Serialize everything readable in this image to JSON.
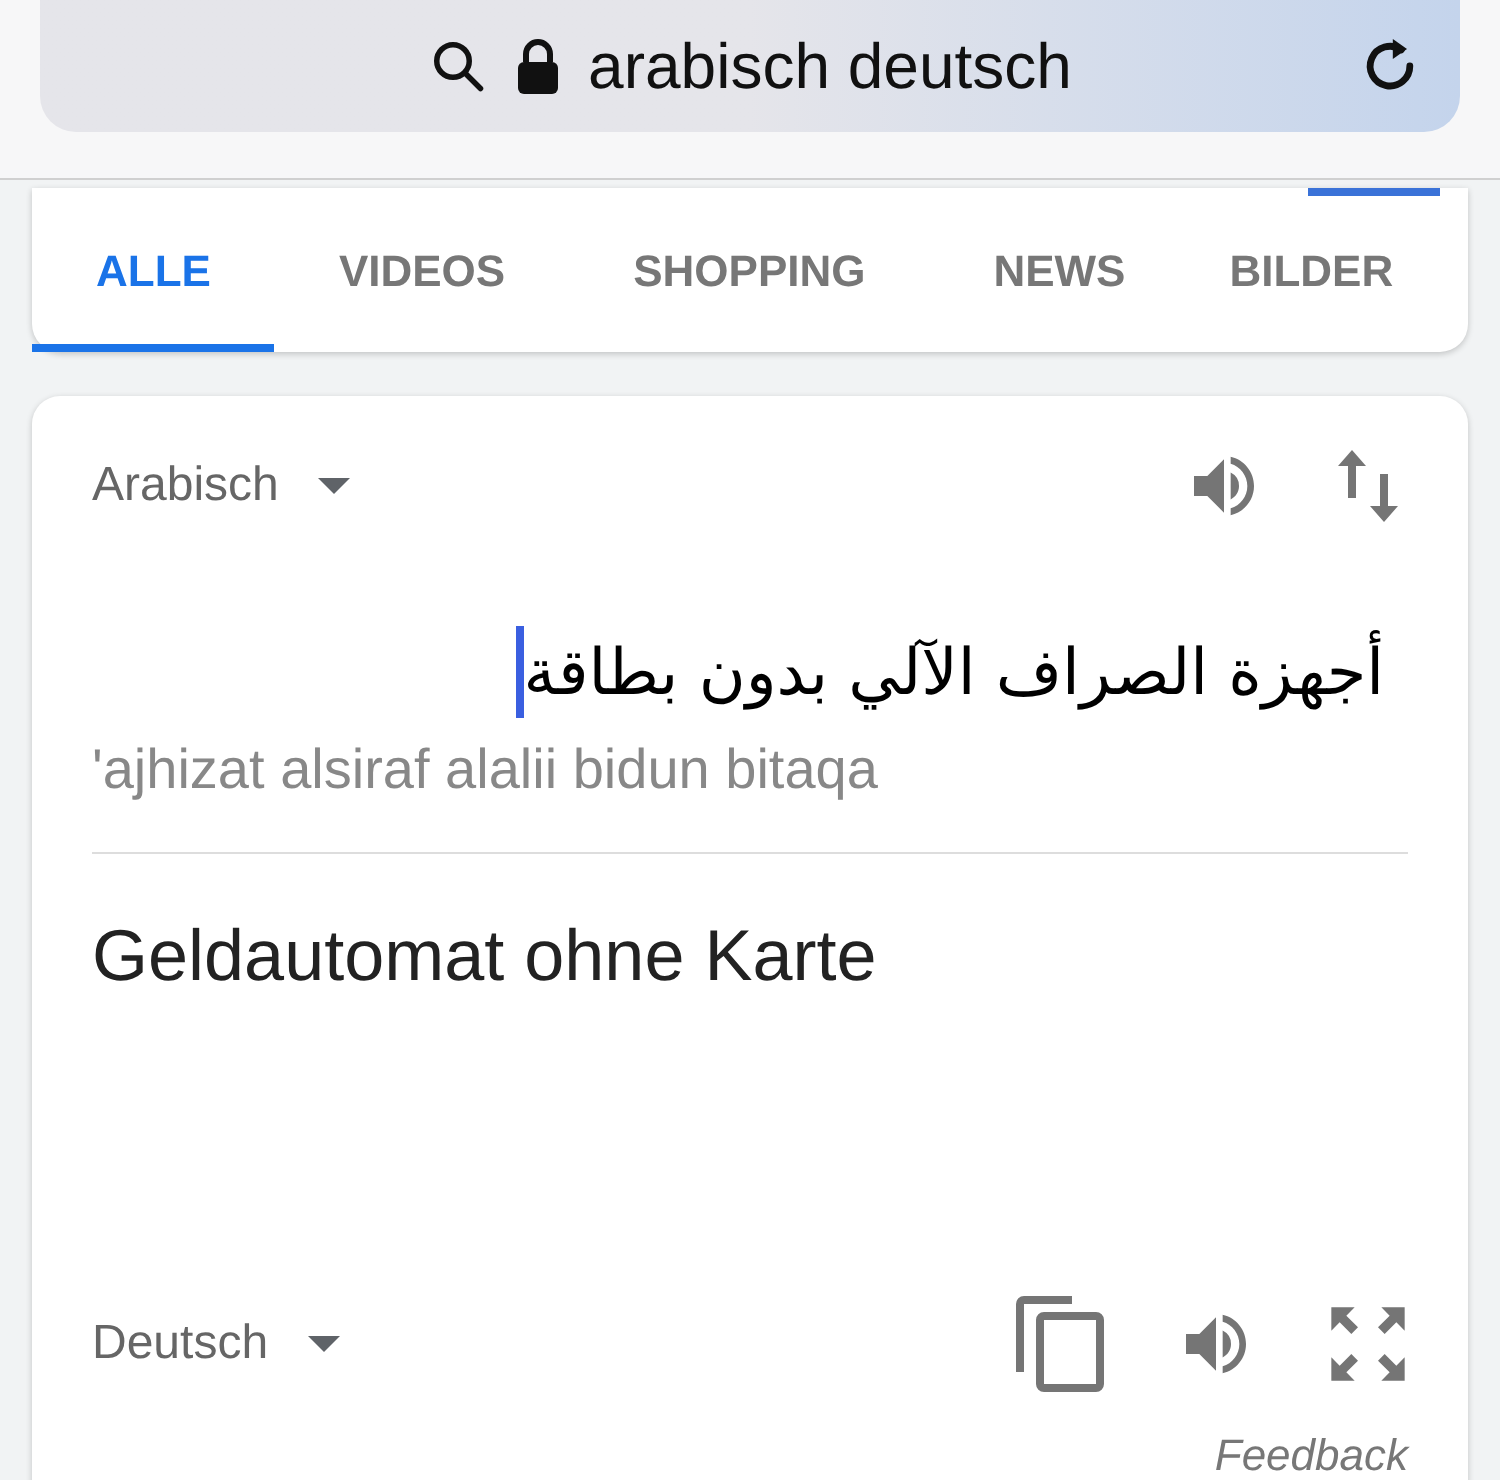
{
  "address_bar": {
    "query": "arabisch deutsch"
  },
  "tabs": [
    {
      "label": "ALLE",
      "selected": true
    },
    {
      "label": "VIDEOS",
      "selected": false
    },
    {
      "label": "SHOPPING",
      "selected": false
    },
    {
      "label": "NEWS",
      "selected": false
    },
    {
      "label": "BILDER",
      "selected": false
    }
  ],
  "translator": {
    "source": {
      "language": "Arabisch",
      "text": "أجهزة الصراف الآلي بدون بطاقة",
      "transliteration": "'ajhizat alsiraf alalii bidun bitaqa"
    },
    "target": {
      "language": "Deutsch",
      "text": "Geldautomat ohne Karte"
    },
    "feedback": "Feedback"
  }
}
